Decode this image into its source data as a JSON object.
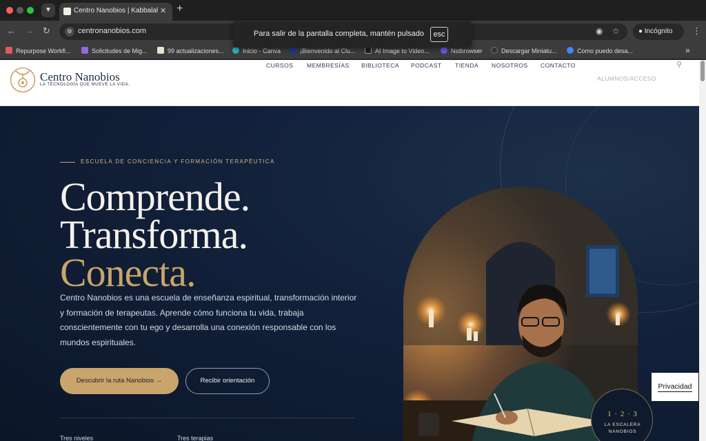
{
  "browser": {
    "tab_title": "Centro Nanobios | Kabbalah y",
    "url": "centronanobios.com",
    "incognito_label": "Incógnito",
    "fullscreen_notice": "Para salir de la pantalla completa, mantén pulsado",
    "fullscreen_key": "esc",
    "bookmarks": [
      {
        "label": "Repurpose Workfl...",
        "color": "#e05a5a"
      },
      {
        "label": "Solicitudes de Mig...",
        "color": "#8e6bd8"
      },
      {
        "label": "99 actualizaciones...",
        "color": "#e8e2d2"
      },
      {
        "label": "Inicio - Canva",
        "color": "#2bb7c9"
      },
      {
        "label": "¡Bienvenido al Clu...",
        "color": "#1f3b8c"
      },
      {
        "label": "AI Image to Video...",
        "color": "#222222"
      },
      {
        "label": "Nstbrowser",
        "color": "#6a5cf0"
      },
      {
        "label": "Descargar Miniatu...",
        "color": "#333333"
      },
      {
        "label": "Como puedo desa...",
        "color": "#4285f4"
      }
    ]
  },
  "site": {
    "logo_name": "Centro Nanobios",
    "logo_tagline": "LA TECNOLOGÍA QUE MUEVE LA VIDA.",
    "nav": [
      "CURSOS",
      "MEMBRESÍAS",
      "BIBLIOTECA",
      "PODCAST",
      "TIENDA",
      "NOSOTROS",
      "CONTACTO"
    ],
    "account_link": "ALUMNOS/ACCESO"
  },
  "hero": {
    "eyebrow": "ESCUELA DE CONCIENCIA Y FORMACIÓN TERAPÉUTICA",
    "line1": "Comprende.",
    "line2": "Transforma.",
    "line3": "Conecta.",
    "body": "Centro Nanobios es una escuela de enseñanza espiritual, transformación interior y formación de terapeutas. Aprende cómo funciona tu vida, trabaja conscientemente con tu ego y desarrolla una conexión responsable con los mundos espirituales.",
    "cta_primary": "Descubrir la ruta Nanobios  →",
    "cta_secondary": "Recibir orientación",
    "stats": [
      "Tres niveles",
      "Tres terapias"
    ],
    "badge_number": "1 · 2 · 3",
    "badge_line1": "LA ESCALERA",
    "badge_line2": "NANOBIOS"
  },
  "privacy_label": "Privacidad",
  "colors": {
    "accent_gold": "#c9a46b",
    "hero_navy": "#12203a",
    "header_white": "#ffffff"
  }
}
